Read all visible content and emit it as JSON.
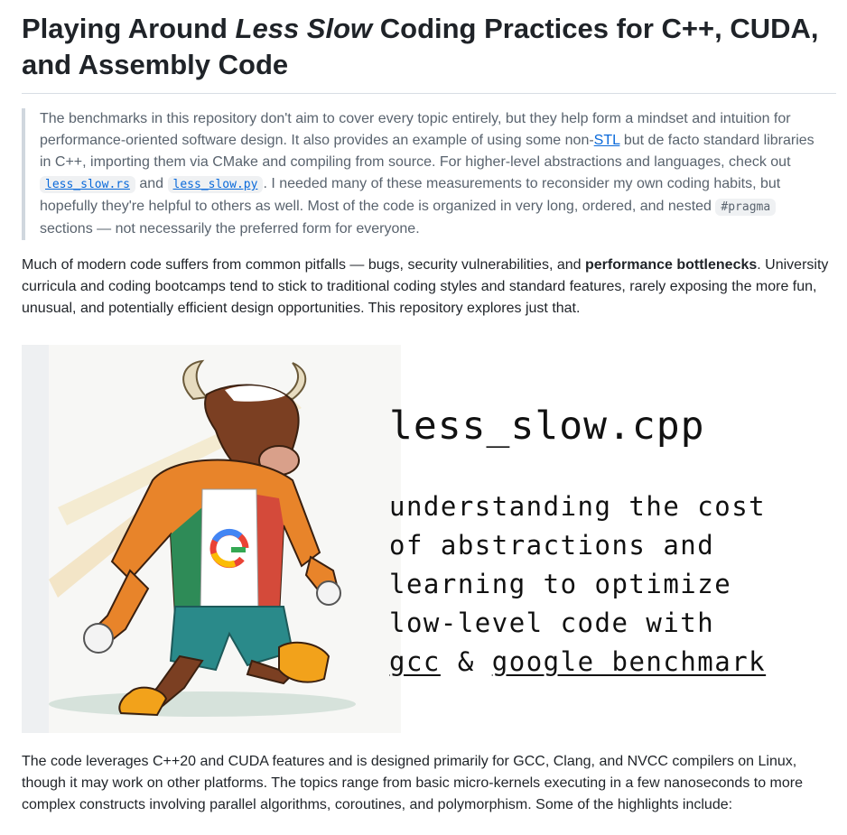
{
  "heading": {
    "part1": "Playing Around ",
    "emph": "Less Slow",
    "part2": " Coding Practices for C++, CUDA, and Assembly Code"
  },
  "quote": {
    "t1": "The benchmarks in this repository don't aim to cover every topic entirely, but they help form a mindset and intuition for performance-oriented software design. It also provides an example of using some non-",
    "link_stl": "STL",
    "t2": " but de facto standard libraries in C++, importing them via CMake and compiling from source. For higher-level abstractions and languages, check out ",
    "code_rs": "less_slow.rs",
    "t3": " and ",
    "code_py": "less_slow.py",
    "t4": ". I needed many of these measurements to reconsider my own coding habits, but hopefully they're helpful to others as well. Most of the code is organized in very long, ordered, and nested ",
    "code_pragma": "#pragma",
    "t5": " sections — not necessarily the preferred form for everyone."
  },
  "intro": {
    "t1": "Much of modern code suffers from common pitfalls — bugs, security vulnerabilities, and ",
    "bold": "performance bottlenecks",
    "t2": ". University curricula and coding bootcamps tend to stick to traditional coding styles and standard features, rarely exposing the more fun, unusual, and potentially efficient design opportunities. This repository explores just that."
  },
  "hero": {
    "title": "less_slow.cpp",
    "line1": "understanding the cost",
    "line2": "of abstractions and",
    "line3": "learning to optimize",
    "line4": "low-level code with",
    "gcc": "gcc",
    "amp": " & ",
    "gbench": "google benchmark"
  },
  "outro": {
    "text": "The code leverages C++20 and CUDA features and is designed primarily for GCC, Clang, and NVCC compilers on Linux, though it may work on other platforms. The topics range from basic micro-kernels executing in a few nanoseconds to more complex constructs involving parallel algorithms, coroutines, and polymorphism. Some of the highlights include:"
  }
}
